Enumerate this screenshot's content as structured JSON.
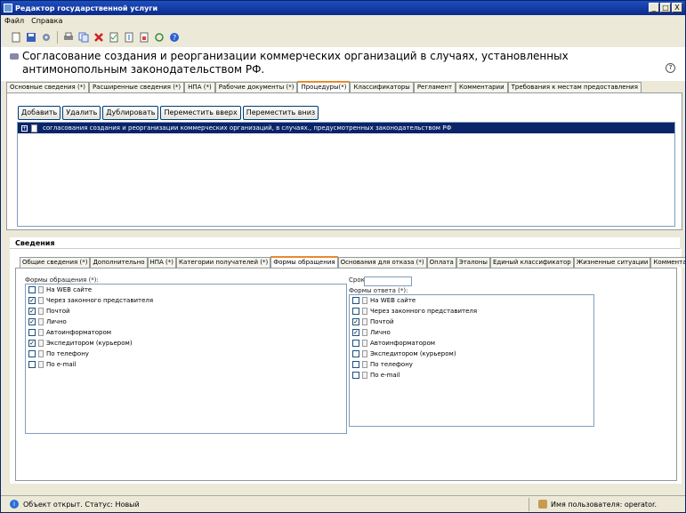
{
  "window": {
    "title": "Редактор государственной услуги",
    "min": "_",
    "max": "□",
    "close": "X"
  },
  "menu": [
    "Файл",
    "Справка"
  ],
  "toolbar_icons": [
    "new-document-icon",
    "save-icon",
    "settings-icon",
    "print-icon",
    "copy-icon",
    "delete-icon",
    "check-icon",
    "import-icon",
    "export-icon",
    "refresh-icon",
    "help-icon"
  ],
  "header": {
    "title": "Согласование создания и реорганизации коммерческих организаций в случаях, установленных антимонопольным законодательством РФ.",
    "help": "?"
  },
  "main_tabs": [
    {
      "label": "Основные сведения (*)"
    },
    {
      "label": "Расширенные сведения (*)"
    },
    {
      "label": "НПА (*)"
    },
    {
      "label": "Рабочие документы (*)"
    },
    {
      "label": "Процедуры(*)",
      "active": true
    },
    {
      "label": "Классификаторы"
    },
    {
      "label": "Регламент"
    },
    {
      "label": "Комментарии"
    },
    {
      "label": "Требования к местам предоставления"
    }
  ],
  "buttons": {
    "add": "Добавить",
    "delete": "Удалить",
    "duplicate": "Дублировать",
    "move_up": "Переместить вверх",
    "move_down": "Переместить вниз"
  },
  "procedures": [
    {
      "expander": "+",
      "label": "согласования создания и реорганизации коммерческих организаций, в случаях., предусмотренных законодательством РФ",
      "selected": true
    }
  ],
  "details": {
    "heading": "Сведения",
    "tabs": [
      {
        "label": "Общие сведения (*)"
      },
      {
        "label": "Дополнительно"
      },
      {
        "label": "НПА (*)"
      },
      {
        "label": "Категории получателей (*)"
      },
      {
        "label": "Формы обращения",
        "active": true
      },
      {
        "label": "Основания для отказа (*)"
      },
      {
        "label": "Оплата"
      },
      {
        "label": "Эталоны"
      },
      {
        "label": "Единый классификатор"
      },
      {
        "label": "Жизненные ситуации"
      },
      {
        "label": "Комментарии"
      }
    ],
    "appeal_forms_label": "Формы обращения (*):",
    "appeal_forms": [
      {
        "label": "На WEB сайте",
        "checked": false
      },
      {
        "label": "Через законного представителя",
        "checked": true
      },
      {
        "label": "Почтой",
        "checked": true
      },
      {
        "label": "Лично",
        "checked": true
      },
      {
        "label": "Автоинформатором",
        "checked": false
      },
      {
        "label": "Экспедитором (курьером)",
        "checked": true
      },
      {
        "label": "По телефону",
        "checked": false
      },
      {
        "label": "По e-mail",
        "checked": false
      }
    ],
    "term_label": "Срок:",
    "term_value": "",
    "response_forms_label": "Формы ответа (*):",
    "response_forms": [
      {
        "label": "На WEB сайте",
        "checked": false
      },
      {
        "label": "Через законного представителя",
        "checked": false
      },
      {
        "label": "Почтой",
        "checked": true
      },
      {
        "label": "Лично",
        "checked": true
      },
      {
        "label": "Автоинформатором",
        "checked": false
      },
      {
        "label": "Экспедитором (курьером)",
        "checked": false
      },
      {
        "label": "По телефону",
        "checked": false
      },
      {
        "label": "По e-mail",
        "checked": false
      }
    ]
  },
  "status": {
    "text": "Объект открыт. Статус: Новый",
    "user": "Имя пользователя: operator."
  }
}
